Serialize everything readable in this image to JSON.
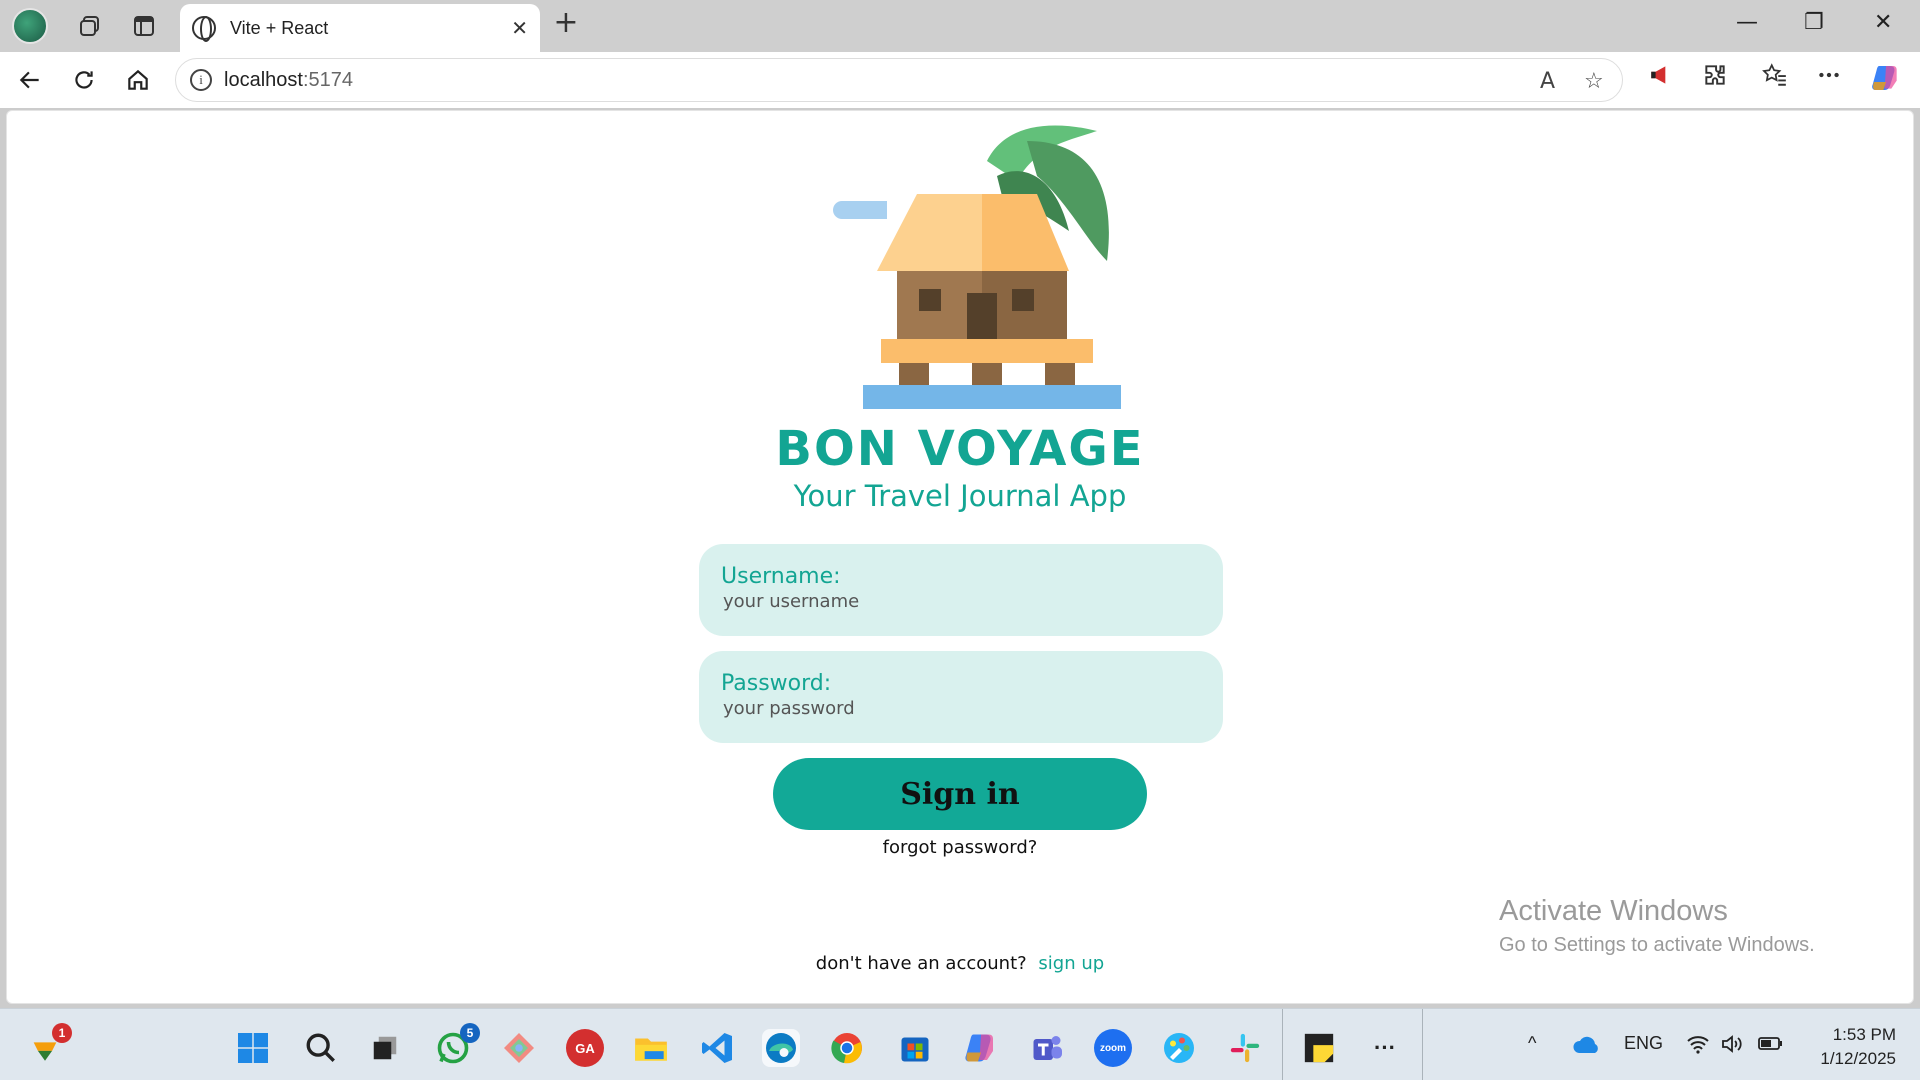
{
  "browser": {
    "tab_title": "Vite + React",
    "url_host": "localhost",
    "url_port": ":5174",
    "new_tab_glyph": "+",
    "close_glyph": "✕",
    "window_minimize": "—",
    "window_restore": "❐",
    "window_close": "✕"
  },
  "page": {
    "brand": "BON VOYAGE",
    "tagline": "Your Travel Journal App",
    "username_label": "Username:",
    "username_placeholder": "your username",
    "password_label": "Password:",
    "password_placeholder": "your password",
    "signin_label": "Sign in",
    "forgot_label": "forgot password?",
    "no_account_text": "don't have an account?",
    "signup_link": "sign up",
    "accent_color": "#13a593"
  },
  "watermark": {
    "line1": "Activate Windows",
    "line2": "Go to Settings to activate Windows."
  },
  "taskbar": {
    "notify_badge": "1",
    "whatsapp_badge": "5",
    "ga_label": "GA",
    "zoom_label": "zoom",
    "more_glyph": "···",
    "tray_chevron": "^",
    "language": "ENG",
    "time": "1:53 PM",
    "date": "1/12/2025"
  }
}
